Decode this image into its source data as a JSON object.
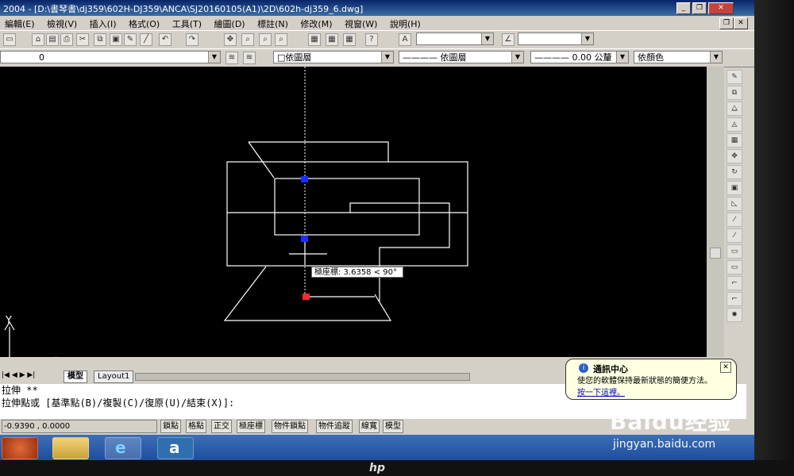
{
  "window": {
    "title": "2004 - [D:\\書琴書\\dj359\\602H-DJ359\\ANCA\\SJ20160105(A1)\\2D\\602h-dj359_6.dwg]"
  },
  "menu": {
    "items": [
      "編輯(E)",
      "檢視(V)",
      "插入(I)",
      "格式(O)",
      "工具(T)",
      "繪圖(D)",
      "標註(N)",
      "修改(M)",
      "視窗(W)",
      "說明(H)"
    ]
  },
  "properties_bar": {
    "layer_value": "0",
    "color_value": "□依圖層",
    "linetype_value": "———— 依圖層",
    "lineweight_value": "———— 0.00 公釐",
    "plotstyle_value": "依顏色"
  },
  "canvas": {
    "background": "#000000",
    "tooltip": "極座標: 3.6358 < 90°",
    "axis_y_label": "Y",
    "axis_x_label": "X",
    "grip_colors": {
      "selected": "#ff2a2a",
      "unselected": "#1e2cff"
    }
  },
  "tabs": {
    "model": "模型",
    "layout": "Layout1"
  },
  "command": {
    "line1": "拉伸 **",
    "line2": "拉伸點或 [基準點(B)/複製(C)/復原(U)/結束(X)]:"
  },
  "status": {
    "coords": "-0.9390 , 0.0000",
    "buttons": [
      "鎖點",
      "格點",
      "正交",
      "極座標",
      "物件鎖點",
      "物件追蹤",
      "線寬",
      "模型"
    ]
  },
  "balloon": {
    "title": "通訊中心",
    "body": "使您的軟體保持最新狀態的簡便方法。",
    "link": "按一下這裡。"
  },
  "monitor": {
    "brand": "hp"
  },
  "watermark": {
    "brand": "Baidu经验",
    "url": "jingyan.baidu.com"
  }
}
